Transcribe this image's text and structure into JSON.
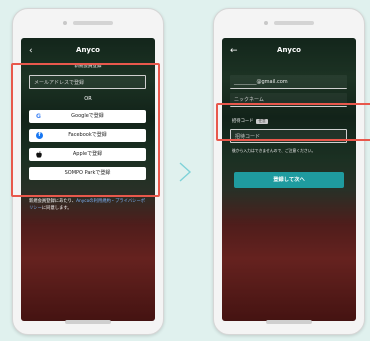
{
  "app_title": "Anyco",
  "left": {
    "section_title": "新規会員登録",
    "email_placeholder": "メールアドレスで登録",
    "or_label": "OR",
    "social": [
      {
        "label": "Googleで登録",
        "icon": "G",
        "icon_name": "google-icon",
        "color": "#4285f4"
      },
      {
        "label": "Facebookで登録",
        "icon": "f",
        "icon_name": "facebook-icon",
        "color": "#1877f2"
      },
      {
        "label": "Appleで登録",
        "icon": "",
        "icon_name": "apple-icon",
        "color": "#111111"
      },
      {
        "label": "SOMPO Parkで登録",
        "icon": "",
        "icon_name": "",
        "color": "#111111"
      }
    ],
    "note_a": "新規会員登録にあたり、",
    "note_link": "Anycoの利用規約・プライバシーポリシー",
    "note_b": "に同意します。"
  },
  "right": {
    "email_value": "_________@gmail.com",
    "nickname_placeholder": "ニックネーム",
    "invite_label": "招待コード",
    "invite_badge": "任意",
    "invite_placeholder": "招待コード",
    "invite_note": "後から入力はできませんので、ご注意ください。",
    "submit_label": "登録して次へ"
  },
  "colors": {
    "highlight": "#e8584c",
    "cta": "#1f9b9f",
    "arrow": "#7fd2d8",
    "bg": "#e0f1ee"
  }
}
